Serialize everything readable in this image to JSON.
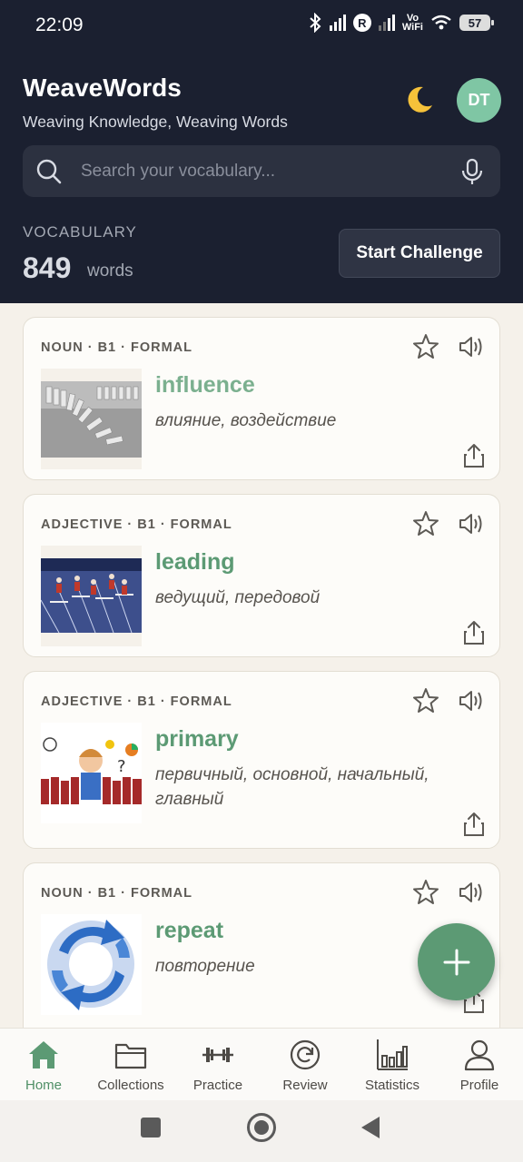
{
  "status_bar": {
    "time": "22:09",
    "network_badge": "R",
    "vowifi": [
      "Vo",
      "WiFi"
    ],
    "battery": "57"
  },
  "header": {
    "title": "WeaveWords",
    "subtitle": "Weaving Knowledge, Weaving Words",
    "theme_icon": "moon-icon",
    "avatar_initials": "DT",
    "avatar_color": "#7fc6a4"
  },
  "search": {
    "placeholder": "Search your vocabulary...",
    "value": ""
  },
  "vocabulary": {
    "label": "VOCABULARY",
    "count": "849",
    "unit": "words"
  },
  "challenge_button": "Start Challenge",
  "cards": [
    {
      "tags": "NOUN · B1 · FORMAL",
      "word": "influence",
      "translation": "влияние, воздействие",
      "image": "dominoes"
    },
    {
      "tags": "ADJECTIVE · B1 · FORMAL",
      "word": "leading",
      "translation": "ведущий, передовой",
      "image": "hurdle-race"
    },
    {
      "tags": "ADJECTIVE · B1 · FORMAL",
      "word": "primary",
      "translation": "первичный, основной, начальный, главный",
      "image": "school-child"
    },
    {
      "tags": "NOUN · B1 · FORMAL",
      "word": "repeat",
      "translation": "повторение",
      "image": "circular-arrows"
    }
  ],
  "nav": [
    {
      "label": "Home",
      "icon": "home-icon",
      "active": true
    },
    {
      "label": "Collections",
      "icon": "folder-icon",
      "active": false
    },
    {
      "label": "Practice",
      "icon": "dumbbell-icon",
      "active": false
    },
    {
      "label": "Review",
      "icon": "refresh-icon",
      "active": false
    },
    {
      "label": "Statistics",
      "icon": "bar-chart-icon",
      "active": false
    },
    {
      "label": "Profile",
      "icon": "user-icon",
      "active": false
    }
  ],
  "colors": {
    "header_bg": "#1b2030",
    "accent": "#5c9a74",
    "background": "#f5f1ea"
  }
}
